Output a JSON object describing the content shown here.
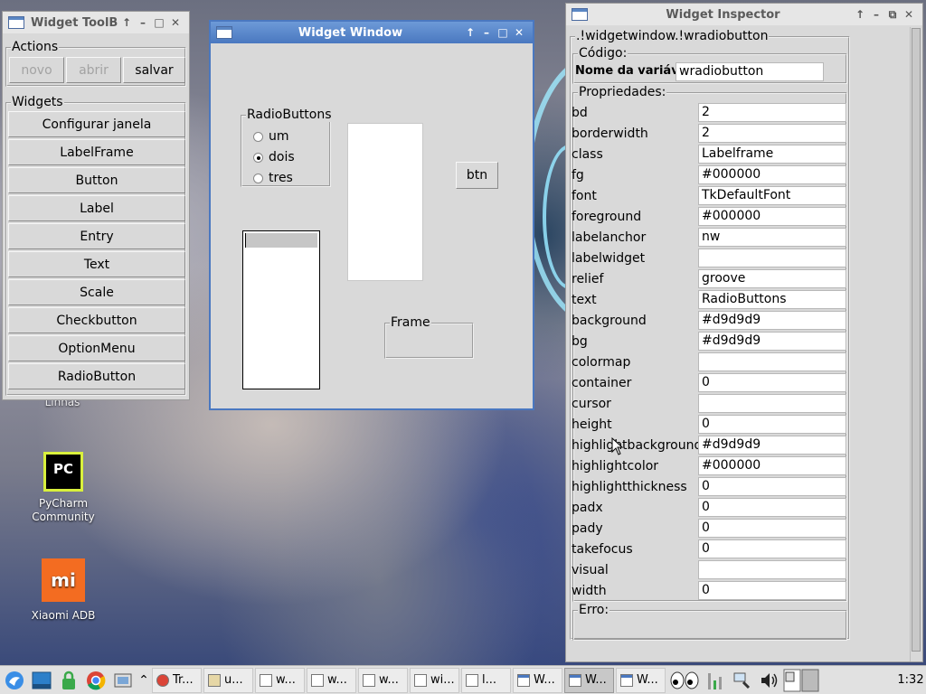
{
  "toolbox": {
    "title": "Widget ToolBo",
    "actions_legend": "Actions",
    "actions": [
      "novo",
      "abrir",
      "salvar"
    ],
    "widgets_legend": "Widgets",
    "widgets": [
      "Configurar janela",
      "LabelFrame",
      "Button",
      "Label",
      "Entry",
      "Text",
      "Scale",
      "Checkbutton",
      "OptionMenu",
      "RadioButton"
    ]
  },
  "widget_window": {
    "title": "Widget Window",
    "radiobuttons_legend": "RadioButtons",
    "radios": [
      {
        "label": "um",
        "selected": false
      },
      {
        "label": "dois",
        "selected": true
      },
      {
        "label": "tres",
        "selected": false
      }
    ],
    "btn_label": "btn",
    "frame_legend": "Frame"
  },
  "inspector": {
    "title": "Widget Inspector",
    "path_legend": ".!widgetwindow.!wradiobutton",
    "code_legend": "Código:",
    "var_label": "Nome da variável",
    "var_value": "wradiobutton",
    "props_legend": "Propriedades:",
    "props": [
      {
        "name": "bd",
        "value": "2"
      },
      {
        "name": "borderwidth",
        "value": "2"
      },
      {
        "name": "class",
        "value": "Labelframe"
      },
      {
        "name": "fg",
        "value": "#000000"
      },
      {
        "name": "font",
        "value": "TkDefaultFont"
      },
      {
        "name": "foreground",
        "value": "#000000"
      },
      {
        "name": "labelanchor",
        "value": "nw"
      },
      {
        "name": "labelwidget",
        "value": ""
      },
      {
        "name": "relief",
        "value": "groove"
      },
      {
        "name": "text",
        "value": "RadioButtons"
      },
      {
        "name": "background",
        "value": "#d9d9d9"
      },
      {
        "name": "bg",
        "value": "#d9d9d9"
      },
      {
        "name": "colormap",
        "value": ""
      },
      {
        "name": "container",
        "value": "0"
      },
      {
        "name": "cursor",
        "value": ""
      },
      {
        "name": "height",
        "value": "0"
      },
      {
        "name": "highlightbackground",
        "value": "#d9d9d9"
      },
      {
        "name": "highlightcolor",
        "value": "#000000"
      },
      {
        "name": "highlightthickness",
        "value": "0"
      },
      {
        "name": "padx",
        "value": "0"
      },
      {
        "name": "pady",
        "value": "0"
      },
      {
        "name": "takefocus",
        "value": "0"
      },
      {
        "name": "visual",
        "value": ""
      },
      {
        "name": "width",
        "value": "0"
      }
    ],
    "error_legend": "Erro:"
  },
  "desktop": {
    "icons": [
      {
        "label": "PyCharm Community",
        "icon": "pycharm-icon",
        "glyph": "PC"
      },
      {
        "label": "Xiaomi ADB",
        "icon": "xiaomi-icon",
        "glyph": "mi"
      }
    ],
    "partial_label": "Linhas"
  },
  "taskbar": {
    "tasks": [
      "Tr...",
      "u...",
      "w...",
      "w...",
      "w...",
      "wi...",
      "l...",
      "W...",
      "W...",
      "W..."
    ],
    "clock": "1:32"
  },
  "colors": {
    "accent": "#4a78c0",
    "window_bg": "#d9d9d9"
  }
}
